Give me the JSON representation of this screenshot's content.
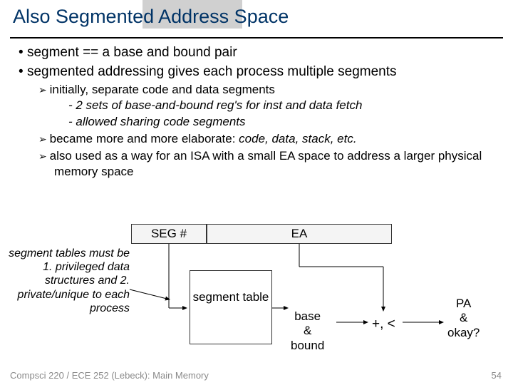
{
  "title": "Also Segmented Address Space",
  "bullets": {
    "b1": "segment == a base and bound pair",
    "b2": "segmented addressing gives each process multiple segments",
    "s1": "initially, separate code and data segments",
    "s1a": "- 2 sets of base-and-bound reg's for inst and data fetch",
    "s1b": "- allowed sharing code segments",
    "s2a": "became more and more elaborate: ",
    "s2b": "code, data, stack, etc.",
    "s3": "also used as a way for an ISA with a small EA space to address a larger physical memory space"
  },
  "diagram": {
    "seg": "SEG #",
    "ea": "EA",
    "note": "segment tables must be 1. privileged data structures and 2. private/unique to each process",
    "segtable": "segment table",
    "bbb": "base & bound",
    "op": "+, <",
    "pa": "PA & okay?"
  },
  "footer": {
    "left": "Compsci 220 / ECE 252 (Lebeck): Main Memory",
    "right": "54"
  }
}
